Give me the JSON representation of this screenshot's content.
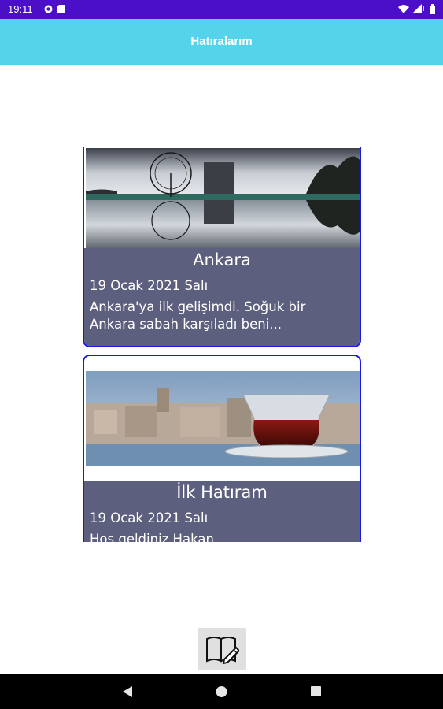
{
  "status_bar": {
    "time": "19:11",
    "icons_left": [
      "notification-app-icon",
      "sd-card-icon"
    ],
    "icons_right": [
      "wifi-icon",
      "signal-icon",
      "battery-icon"
    ]
  },
  "app_bar": {
    "title": "Hatıralarım",
    "color": "#55d3eb"
  },
  "memories": [
    {
      "title": "Ankara",
      "date": "19 Ocak 2021 Salı",
      "text": "Ankara'ya ilk gelişimdi. Soğuk bir Ankara sabah karşıladı beni..."
    },
    {
      "title": "İlk Hatıram",
      "date": "19 Ocak 2021 Salı",
      "text": "Hoş geldiniz Hakan"
    }
  ],
  "colors": {
    "status_bar": "#4b0fc7",
    "card_border": "#1a1ae0",
    "card_info_bg": "#5c5f7d"
  },
  "add_button": {
    "icon": "book-pencil-icon"
  },
  "nav_bar": {
    "buttons": [
      "back-icon",
      "home-icon",
      "recents-icon"
    ]
  }
}
